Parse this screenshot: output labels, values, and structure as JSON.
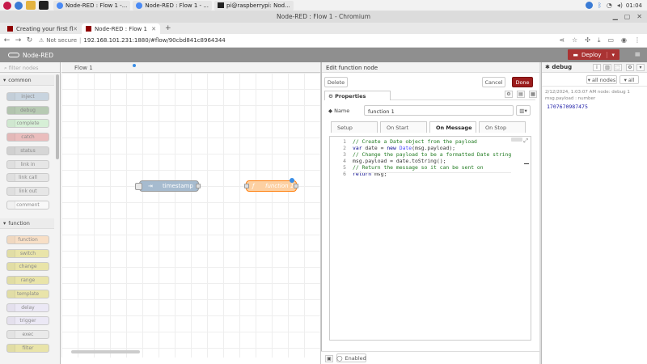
{
  "os": {
    "taskbar": [
      {
        "label": "Node-RED : Flow 1 -..."
      },
      {
        "label": "Node-RED : Flow 1 - ..."
      },
      {
        "label": "pi@raspberrypi: Nod..."
      }
    ],
    "clock": "01:04"
  },
  "browser": {
    "window_title": "Node-RED : Flow 1 - Chromium",
    "tabs": [
      {
        "label": "Creating your first flow"
      },
      {
        "label": "Node-RED : Flow 1"
      }
    ],
    "security_label": "Not secure",
    "url": "192.168.101.231:1880/#flow/90cbd841c8964344"
  },
  "nodered": {
    "app_name": "Node-RED",
    "deploy_label": "Deploy",
    "filter_placeholder": "filter nodes",
    "palette": {
      "common_label": "common",
      "common_nodes": [
        "inject",
        "debug",
        "complete",
        "catch",
        "status",
        "link in",
        "link call",
        "link out",
        "comment"
      ],
      "function_label": "function",
      "function_nodes": [
        "function",
        "switch",
        "change",
        "range",
        "template",
        "delay",
        "trigger",
        "exec",
        "filter"
      ]
    },
    "flow_tab": "Flow 1",
    "canvas_nodes": {
      "timestamp": "timestamp",
      "function": "function 1"
    },
    "colors": {
      "header": "#8f8f8f",
      "deploy": "#aa3333",
      "done": "#9b1c1c",
      "inject_node": "#a6bbcf",
      "function_node": "#fdd0a2",
      "debug_node": "#87a980"
    }
  },
  "editor": {
    "title": "Edit function node",
    "delete_label": "Delete",
    "cancel_label": "Cancel",
    "done_label": "Done",
    "properties_label": "Properties",
    "name_label": "Name",
    "name_value": "function 1",
    "tabs": [
      "Setup",
      "On Start",
      "On Message",
      "On Stop"
    ],
    "active_tab": "On Message",
    "code": [
      {
        "n": "1",
        "text": "// Create a Date object from the payload"
      },
      {
        "n": "2",
        "text": "var date = new Date(msg.payload);"
      },
      {
        "n": "3",
        "text": "// Change the payload to be a formatted Date string"
      },
      {
        "n": "4",
        "text": "msg.payload = date.toString();"
      },
      {
        "n": "5",
        "text": "// Return the message so it can be sent on"
      },
      {
        "n": "6",
        "text": "return msg;"
      }
    ],
    "enabled_label": "Enabled"
  },
  "debug": {
    "tab_label": "debug",
    "filter_label": "all nodes",
    "clear_label": "all",
    "message": {
      "meta": "2/12/2024, 1:03:07 AM   node: debug 1",
      "type": "msg.payload : number",
      "value": "1707670987475"
    }
  }
}
